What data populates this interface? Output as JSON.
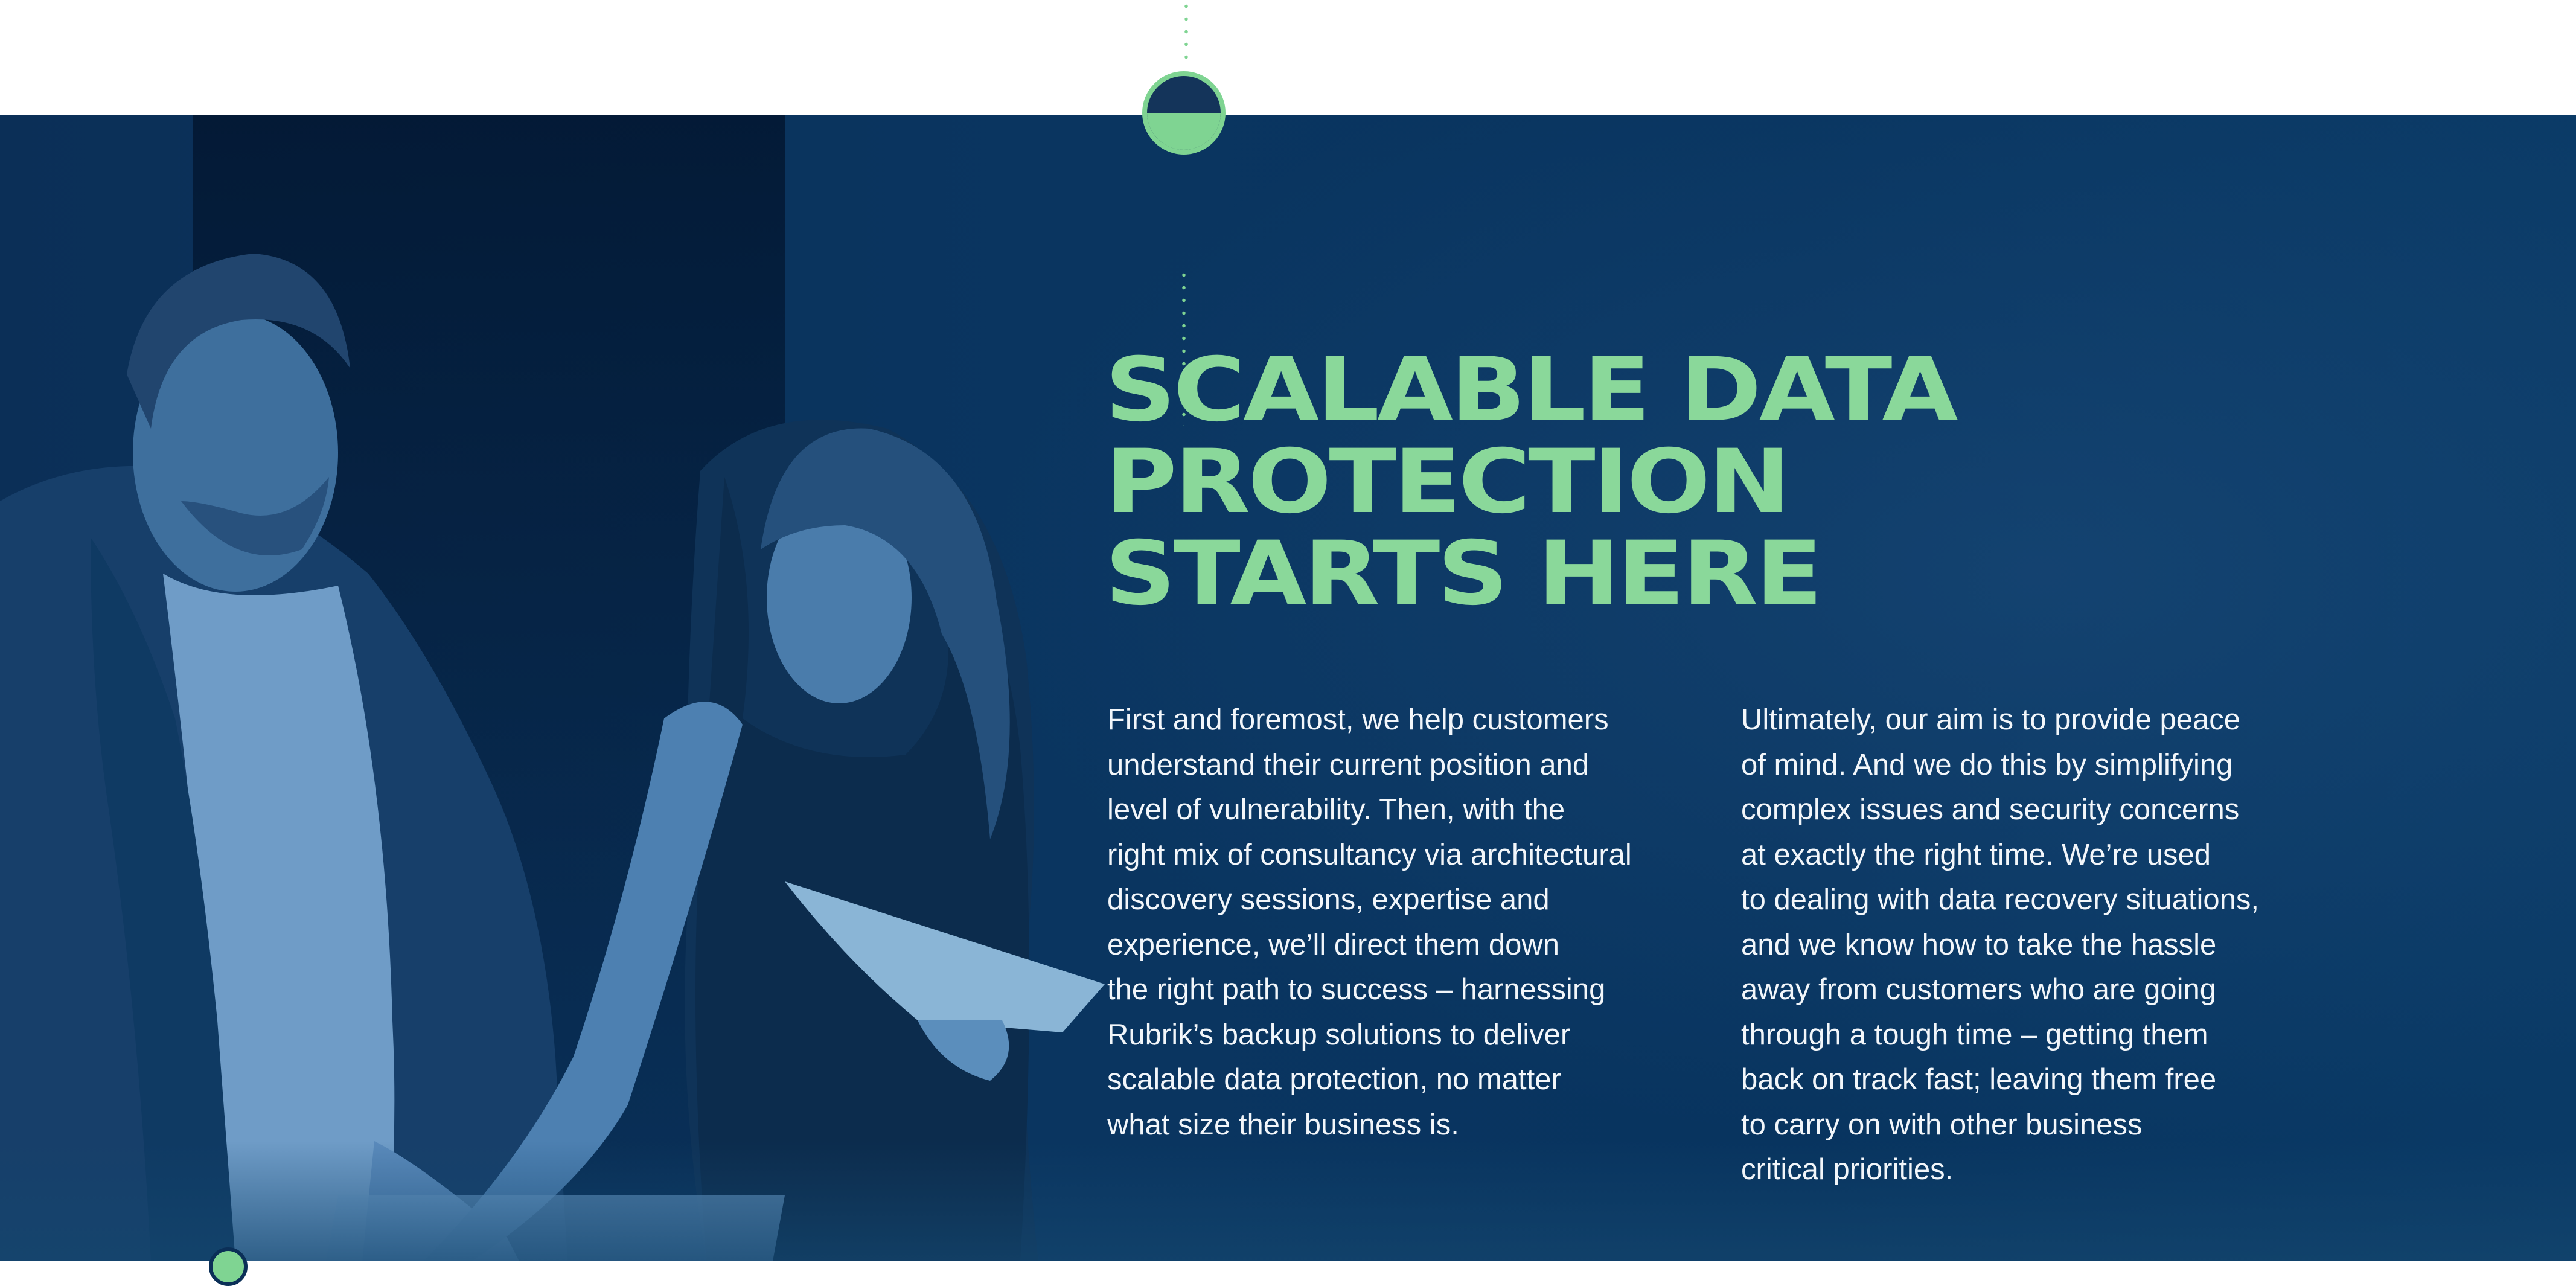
{
  "headline": {
    "line1": "SCALABLE DATA",
    "line2": "PROTECTION",
    "line3": "STARTS HERE"
  },
  "body": {
    "left_lines": [
      "First and foremost, we help customers",
      "understand their current position and",
      "level of vulnerability. Then, with the",
      "right mix of consultancy via architectural",
      "discovery sessions, expertise and",
      "experience, we’ll direct them down",
      "the right path to success – harnessing",
      "Rubrik’s backup solutions to deliver",
      "scalable data protection, no matter",
      "what size their business is."
    ],
    "right_lines": [
      "Ultimately, our aim is to provide peace",
      "of mind. And we do this by simplifying",
      "complex issues and security concerns",
      "at exactly the right time. We’re used",
      "to dealing with data recovery situations,",
      "and we know how to take the hassle",
      "away from customers who are going",
      "through a tough time – getting them",
      "back on track fast; leaving them free",
      "to carry on with other business",
      "critical priorities."
    ]
  },
  "colors": {
    "accent_green": "#7fd492",
    "headline_green": "#8ad89a",
    "hero_navy": "#0b2f57",
    "body_text": "#f2f6fa"
  },
  "icons": {
    "divider_marker": "half-filled-circle-icon",
    "corner_marker": "green-dot-icon"
  }
}
